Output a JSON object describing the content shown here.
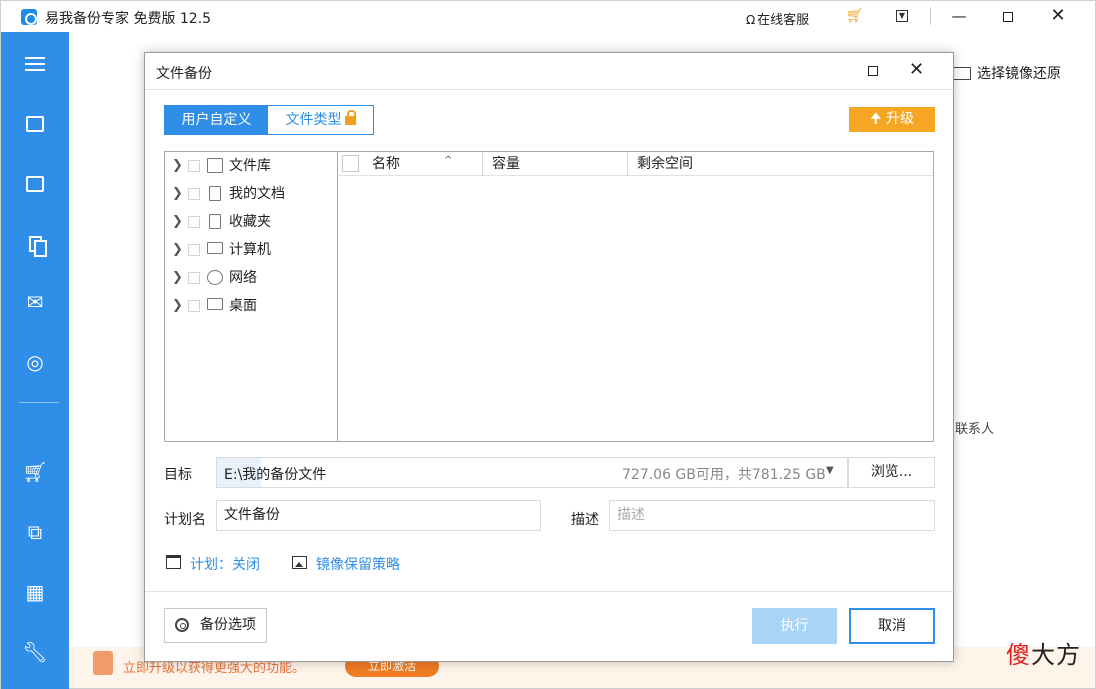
{
  "app": {
    "title": "易我备份专家 免费版 12.5",
    "support": "在线客服",
    "cart_icon": "cart-icon",
    "menu_icon": "dropdown-menu-icon",
    "minimize": "—",
    "close": "✕"
  },
  "sidebar": {
    "items": [
      {
        "icon": "hamburger-menu-icon"
      },
      {
        "icon": "disk-backup-icon"
      },
      {
        "icon": "system-backup-icon"
      },
      {
        "icon": "file-backup-icon"
      },
      {
        "icon": "mail-backup-icon"
      },
      {
        "icon": "smart-backup-icon"
      },
      {
        "icon": "cart-icon"
      },
      {
        "icon": "clone-icon"
      },
      {
        "icon": "tools-grid-icon"
      },
      {
        "icon": "wrench-icon"
      }
    ]
  },
  "background": {
    "restore_label": "选择镜像还原",
    "contact": "联系人",
    "promo_text": "立即升级以获得更强大的功能。",
    "promo_button": "立即激活",
    "watermark_red": "傻",
    "watermark_rest": "大方"
  },
  "dialog": {
    "title": "文件备份",
    "tabs": [
      {
        "label": "用户自定义",
        "active": true
      },
      {
        "label": "文件类型",
        "locked": true
      }
    ],
    "upgrade_label": "升级",
    "upgrade_arrow": "🠉",
    "tree": [
      {
        "label": "文件库",
        "icon": "folder-icon"
      },
      {
        "label": "我的文档",
        "icon": "document-icon"
      },
      {
        "label": "收藏夹",
        "icon": "favorites-icon"
      },
      {
        "label": "计算机",
        "icon": "computer-icon"
      },
      {
        "label": "网络",
        "icon": "network-icon"
      },
      {
        "label": "桌面",
        "icon": "desktop-icon"
      }
    ],
    "list_columns": [
      "名称",
      "容量",
      "剩余空间"
    ],
    "sort_caret": "^",
    "target_label": "目标",
    "target_path": "E:\\我的备份文件",
    "target_free": "727.06 GB可用，共781.25 GB",
    "browse_label": "浏览...",
    "plan_label": "计划名",
    "plan_value": "文件备份",
    "desc_label": "描述",
    "desc_placeholder": "描述",
    "schedule_link": "计划：关闭",
    "retention_link": "镜像保留策略",
    "options_button": "备份选项",
    "execute_button": "执行",
    "cancel_button": "取消",
    "accent_color": "#2e8ee8",
    "upgrade_color": "#f5a623"
  }
}
